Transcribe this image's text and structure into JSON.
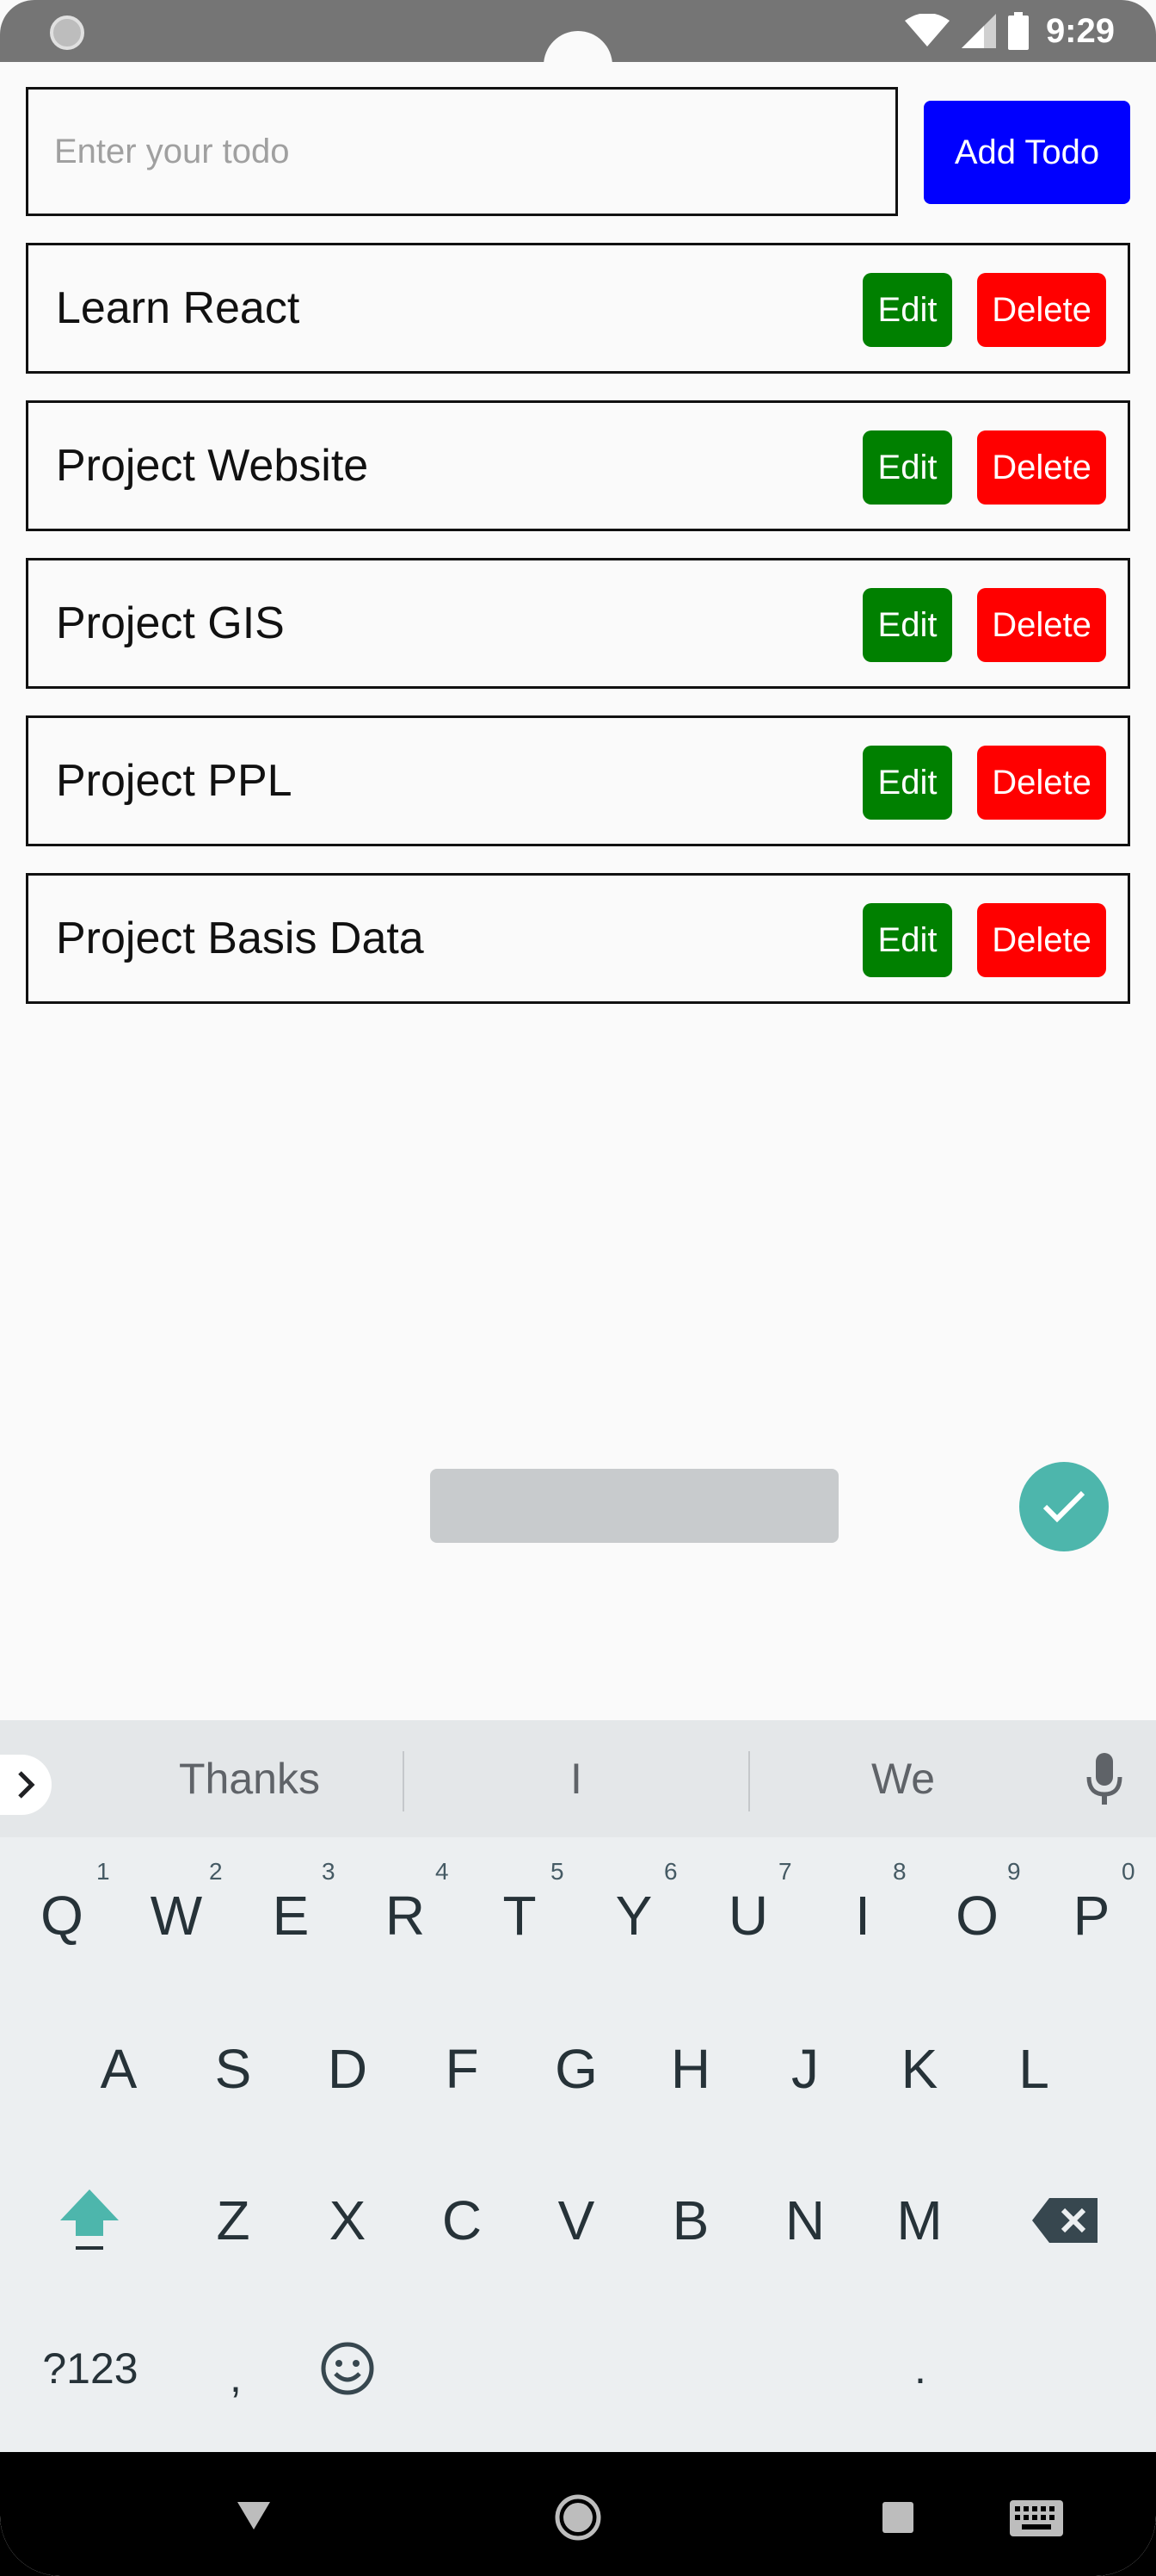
{
  "status_bar": {
    "time": "9:29",
    "icons": [
      "wifi-icon",
      "signal-icon",
      "battery-icon"
    ]
  },
  "input": {
    "placeholder": "Enter your todo",
    "value": ""
  },
  "add_button": {
    "label": "Add Todo",
    "color": "#0000ff"
  },
  "todos": [
    {
      "text": "Learn React",
      "edit_label": "Edit",
      "delete_label": "Delete"
    },
    {
      "text": "Project Website",
      "edit_label": "Edit",
      "delete_label": "Delete"
    },
    {
      "text": "Project GIS",
      "edit_label": "Edit",
      "delete_label": "Delete"
    },
    {
      "text": "Project PPL",
      "edit_label": "Edit",
      "delete_label": "Delete"
    },
    {
      "text": "Project Basis Data",
      "edit_label": "Edit",
      "delete_label": "Delete"
    }
  ],
  "colors": {
    "edit": "#008000",
    "delete": "#ff0000",
    "accent": "#4db6ac"
  },
  "keyboard": {
    "suggestions": [
      "Thanks",
      "I",
      "We"
    ],
    "row1": [
      "Q",
      "W",
      "E",
      "R",
      "T",
      "Y",
      "U",
      "I",
      "O",
      "P"
    ],
    "row1_hints": [
      "1",
      "2",
      "3",
      "4",
      "5",
      "6",
      "7",
      "8",
      "9",
      "0"
    ],
    "row2": [
      "A",
      "S",
      "D",
      "F",
      "G",
      "H",
      "J",
      "K",
      "L"
    ],
    "row3": [
      "Z",
      "X",
      "C",
      "V",
      "B",
      "N",
      "M"
    ],
    "symbols_label": "?123",
    "comma": ",",
    "period": "."
  }
}
